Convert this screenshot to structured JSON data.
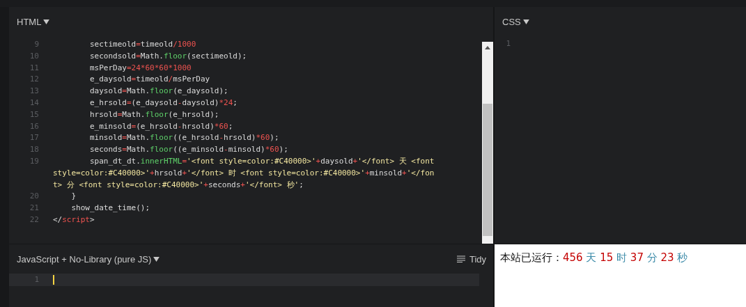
{
  "html_panel": {
    "title": "HTML",
    "lines": [
      {
        "number": "9",
        "tokens": [
          {
            "kind": "text",
            "text": "        sectimeold"
          },
          {
            "kind": "op",
            "text": "="
          },
          {
            "kind": "text",
            "text": "timeold"
          },
          {
            "kind": "op",
            "text": "/"
          },
          {
            "kind": "num",
            "text": "1000"
          }
        ]
      },
      {
        "number": "10",
        "tokens": [
          {
            "kind": "text",
            "text": "        secondsold"
          },
          {
            "kind": "op",
            "text": "="
          },
          {
            "kind": "text",
            "text": "Math."
          },
          {
            "kind": "fn",
            "text": "floor"
          },
          {
            "kind": "text",
            "text": "(sectimeold);"
          }
        ]
      },
      {
        "number": "11",
        "tokens": [
          {
            "kind": "text",
            "text": "        msPerDay"
          },
          {
            "kind": "op",
            "text": "="
          },
          {
            "kind": "num",
            "text": "24*60*60*1000"
          }
        ]
      },
      {
        "number": "12",
        "tokens": [
          {
            "kind": "text",
            "text": "        e_daysold"
          },
          {
            "kind": "op",
            "text": "="
          },
          {
            "kind": "text",
            "text": "timeold"
          },
          {
            "kind": "op",
            "text": "/"
          },
          {
            "kind": "text",
            "text": "msPerDay"
          }
        ]
      },
      {
        "number": "13",
        "tokens": [
          {
            "kind": "text",
            "text": "        daysold"
          },
          {
            "kind": "op",
            "text": "="
          },
          {
            "kind": "text",
            "text": "Math."
          },
          {
            "kind": "fn",
            "text": "floor"
          },
          {
            "kind": "text",
            "text": "(e_daysold);"
          }
        ]
      },
      {
        "number": "14",
        "tokens": [
          {
            "kind": "text",
            "text": "        e_hrsold"
          },
          {
            "kind": "op",
            "text": "="
          },
          {
            "kind": "text",
            "text": "(e_daysold"
          },
          {
            "kind": "op",
            "text": "-"
          },
          {
            "kind": "text",
            "text": "daysold)"
          },
          {
            "kind": "num",
            "text": "*24"
          },
          {
            "kind": "text",
            "text": ";"
          }
        ]
      },
      {
        "number": "15",
        "tokens": [
          {
            "kind": "text",
            "text": "        hrsold"
          },
          {
            "kind": "op",
            "text": "="
          },
          {
            "kind": "text",
            "text": "Math."
          },
          {
            "kind": "fn",
            "text": "floor"
          },
          {
            "kind": "text",
            "text": "(e_hrsold);"
          }
        ]
      },
      {
        "number": "16",
        "tokens": [
          {
            "kind": "text",
            "text": "        e_minsold"
          },
          {
            "kind": "op",
            "text": "="
          },
          {
            "kind": "text",
            "text": "(e_hrsold"
          },
          {
            "kind": "op",
            "text": "-"
          },
          {
            "kind": "text",
            "text": "hrsold)"
          },
          {
            "kind": "num",
            "text": "*60"
          },
          {
            "kind": "text",
            "text": ";"
          }
        ]
      },
      {
        "number": "17",
        "tokens": [
          {
            "kind": "text",
            "text": "        minsold"
          },
          {
            "kind": "op",
            "text": "="
          },
          {
            "kind": "text",
            "text": "Math."
          },
          {
            "kind": "fn",
            "text": "floor"
          },
          {
            "kind": "text",
            "text": "((e_hrsold"
          },
          {
            "kind": "op",
            "text": "-"
          },
          {
            "kind": "text",
            "text": "hrsold)"
          },
          {
            "kind": "num",
            "text": "*60"
          },
          {
            "kind": "text",
            "text": ");"
          }
        ]
      },
      {
        "number": "18",
        "tokens": [
          {
            "kind": "text",
            "text": "        seconds"
          },
          {
            "kind": "op",
            "text": "="
          },
          {
            "kind": "text",
            "text": "Math."
          },
          {
            "kind": "fn",
            "text": "floor"
          },
          {
            "kind": "text",
            "text": "((e_minsold"
          },
          {
            "kind": "op",
            "text": "-"
          },
          {
            "kind": "text",
            "text": "minsold)"
          },
          {
            "kind": "num",
            "text": "*60"
          },
          {
            "kind": "text",
            "text": ");"
          }
        ]
      },
      {
        "number": "19",
        "tokens": [
          {
            "kind": "text",
            "text": "        span_dt_dt."
          },
          {
            "kind": "fn",
            "text": "innerHTML"
          },
          {
            "kind": "op",
            "text": "="
          },
          {
            "kind": "str",
            "text": "'<font style=color:#C40000>'"
          },
          {
            "kind": "op",
            "text": "+"
          },
          {
            "kind": "text",
            "text": "daysold"
          },
          {
            "kind": "op",
            "text": "+"
          },
          {
            "kind": "str",
            "text": "'</font> 天 <font style=color:#C40000>'"
          },
          {
            "kind": "op",
            "text": "+"
          },
          {
            "kind": "text",
            "text": "hrsold"
          },
          {
            "kind": "op",
            "text": "+"
          },
          {
            "kind": "str",
            "text": "'</font> 时 <font style=color:#C40000>'"
          },
          {
            "kind": "op",
            "text": "+"
          },
          {
            "kind": "text",
            "text": "minsold"
          },
          {
            "kind": "op",
            "text": "+"
          },
          {
            "kind": "str",
            "text": "'</font> 分 <font style=color:#C40000>'"
          },
          {
            "kind": "op",
            "text": "+"
          },
          {
            "kind": "text",
            "text": "seconds"
          },
          {
            "kind": "op",
            "text": "+"
          },
          {
            "kind": "str",
            "text": "'</font> 秒'"
          },
          {
            "kind": "text",
            "text": ";"
          }
        ]
      },
      {
        "number": "20",
        "tokens": [
          {
            "kind": "text",
            "text": "    }"
          }
        ]
      },
      {
        "number": "21",
        "tokens": [
          {
            "kind": "text",
            "text": "    show_date_time();"
          }
        ]
      },
      {
        "number": "22",
        "tokens": [
          {
            "kind": "text",
            "text": "</"
          },
          {
            "kind": "tag",
            "text": "script"
          },
          {
            "kind": "text",
            "text": ">"
          }
        ]
      }
    ]
  },
  "css_panel": {
    "title": "CSS",
    "lines": [
      {
        "number": "1"
      }
    ]
  },
  "js_panel": {
    "title": "JavaScript + No-Library (pure JS)",
    "tidy_button": "Tidy",
    "lines": [
      {
        "number": "1",
        "active": true
      }
    ]
  },
  "result": {
    "segments": [
      {
        "kind": "label",
        "text": "本站已运行："
      },
      {
        "kind": "value",
        "text": "456"
      },
      {
        "kind": "unit",
        "text": "天"
      },
      {
        "kind": "value",
        "text": "15"
      },
      {
        "kind": "unit",
        "text": "时"
      },
      {
        "kind": "value",
        "text": "37"
      },
      {
        "kind": "unit",
        "text": "分"
      },
      {
        "kind": "value",
        "text": "23"
      },
      {
        "kind": "unit",
        "text": "秒"
      }
    ]
  }
}
